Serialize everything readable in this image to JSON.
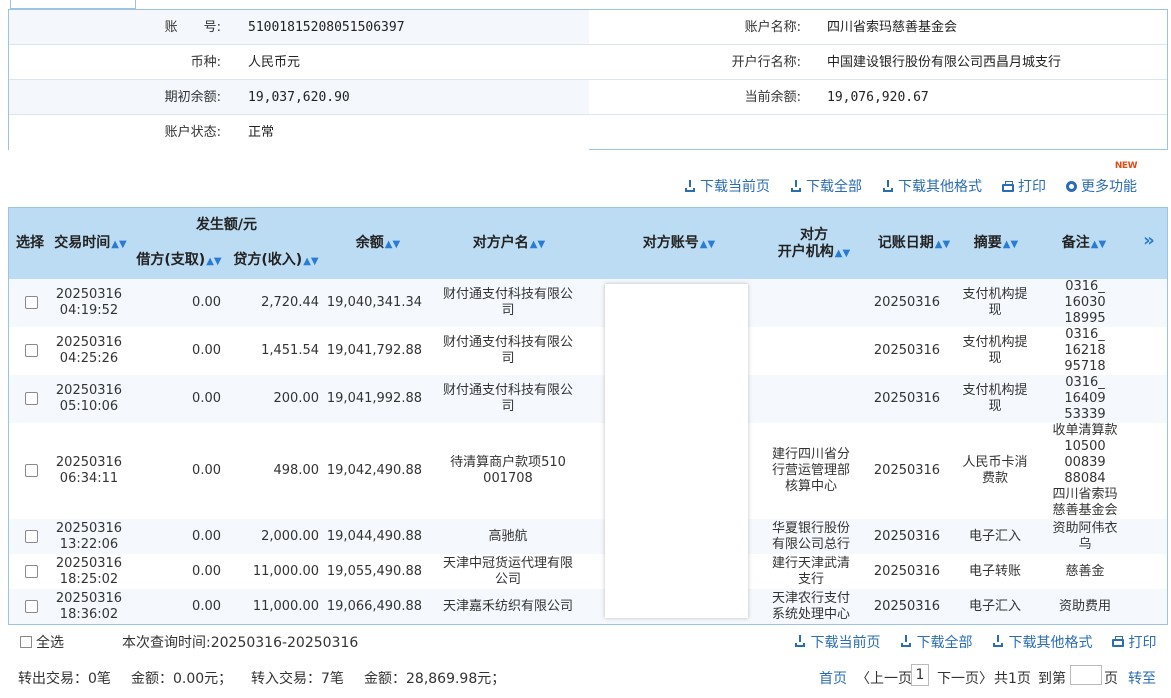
{
  "account": {
    "rows": [
      {
        "l1": "账　　号:",
        "v1": "51001815208051506397",
        "l2": "账户名称:",
        "v2": "四川省索玛慈善基金会"
      },
      {
        "l1": "币种:",
        "v1": "人民币元",
        "l2": "开户行名称:",
        "v2": "中国建设银行股份有限公司西昌月城支行"
      },
      {
        "l1": "期初余额:",
        "v1": "19,037,620.90",
        "l2": "当前余额:",
        "v2": "19,076,920.67"
      },
      {
        "l1": "账户状态:",
        "v1": "正常",
        "l2": "",
        "v2": ""
      }
    ]
  },
  "toolbar": {
    "download_page": "下载当前页",
    "download_all": "下载全部",
    "download_other": "下载其他格式",
    "print": "打印",
    "more": "更多功能",
    "new_badge": "NEW"
  },
  "table": {
    "headers": {
      "select": "选择",
      "time": "交易时间",
      "amount_group": "发生额/元",
      "debit": "借方(支取)",
      "credit": "贷方(收入)",
      "balance": "余额",
      "counter_name": "对方户名",
      "counter_account": "对方账号",
      "counter_bank_1": "对方",
      "counter_bank_2": "开户机构",
      "post_date": "记账日期",
      "summary": "摘要",
      "remark": "备注",
      "expand": "»"
    },
    "rows": [
      {
        "date": "20250316",
        "time": "04:19:52",
        "debit": "0.00",
        "credit": "2,720.44",
        "balance": "19,040,341.34",
        "name": [
          "财付通支付科技有限公",
          "司"
        ],
        "bank": [],
        "post": "20250316",
        "summary": [
          "支付机构提",
          "现"
        ],
        "remark": [
          "0316_",
          "16030",
          "18995"
        ]
      },
      {
        "date": "20250316",
        "time": "04:25:26",
        "debit": "0.00",
        "credit": "1,451.54",
        "balance": "19,041,792.88",
        "name": [
          "财付通支付科技有限公",
          "司"
        ],
        "bank": [],
        "post": "20250316",
        "summary": [
          "支付机构提",
          "现"
        ],
        "remark": [
          "0316_",
          "16218",
          "95718"
        ]
      },
      {
        "date": "20250316",
        "time": "05:10:06",
        "debit": "0.00",
        "credit": "200.00",
        "balance": "19,041,992.88",
        "name": [
          "财付通支付科技有限公",
          "司"
        ],
        "bank": [],
        "post": "20250316",
        "summary": [
          "支付机构提",
          "现"
        ],
        "remark": [
          "0316_",
          "16409",
          "53339"
        ]
      },
      {
        "date": "20250316",
        "time": "06:34:11",
        "debit": "0.00",
        "credit": "498.00",
        "balance": "19,042,490.88",
        "name": [
          "待清算商户款项510",
          "001708"
        ],
        "bank": [
          "建行四川省分",
          "行营运管理部",
          "核算中心"
        ],
        "post": "20250316",
        "summary": [
          "人民币卡消",
          "费款"
        ],
        "remark": [
          "收单清算款",
          "10500",
          "00839",
          "88084",
          "四川省索玛",
          "慈善基金会"
        ]
      },
      {
        "date": "20250316",
        "time": "13:22:06",
        "debit": "0.00",
        "credit": "2,000.00",
        "balance": "19,044,490.88",
        "name": [
          "高驰航"
        ],
        "bank": [
          "华夏银行股份",
          "有限公司总行"
        ],
        "post": "20250316",
        "summary": [
          "电子汇入"
        ],
        "remark": [
          "资助阿伟衣",
          "乌"
        ]
      },
      {
        "date": "20250316",
        "time": "18:25:02",
        "debit": "0.00",
        "credit": "11,000.00",
        "balance": "19,055,490.88",
        "name": [
          "天津中冠货运代理有限",
          "公司"
        ],
        "bank": [
          "建行天津武清",
          "支行"
        ],
        "post": "20250316",
        "summary": [
          "电子转账"
        ],
        "remark": [
          "慈善金"
        ]
      },
      {
        "date": "20250316",
        "time": "18:36:02",
        "debit": "0.00",
        "credit": "11,000.00",
        "balance": "19,066,490.88",
        "name": [
          "天津嘉禾纺织有限公司"
        ],
        "bank": [
          "天津农行支付",
          "系统处理中心"
        ],
        "post": "20250316",
        "summary": [
          "电子汇入"
        ],
        "remark": [
          "资助费用"
        ]
      }
    ]
  },
  "footer": {
    "select_all": "全选",
    "query_time": "本次查询时间:20250316-20250316",
    "download_page": "下载当前页",
    "download_all": "下载全部",
    "download_other": "下载其他格式",
    "print": "打印",
    "out_count": "转出交易：0笔",
    "out_amount": "金额：0.00元；",
    "in_count": "转入交易：7笔",
    "in_amount": "金额：28,869.98元；",
    "first": "首页",
    "prev": "〈上一页",
    "page": "1",
    "next": "下一页〉",
    "total": "共1页",
    "goto_label": "到第",
    "page_unit": "页",
    "goto_btn": "转至"
  }
}
